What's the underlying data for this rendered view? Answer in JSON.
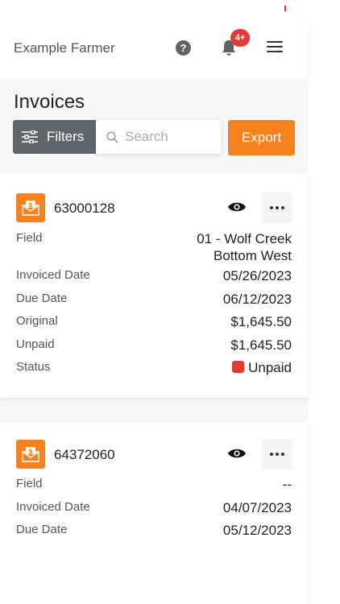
{
  "header": {
    "farmer_name": "Example Farmer",
    "help_icon_label": "?",
    "notification_count": "4+"
  },
  "page": {
    "title": "Invoices",
    "filters_label": "Filters",
    "search_placeholder": "Search",
    "export_label": "Export"
  },
  "invoices": [
    {
      "number": "63000128",
      "field_label": "Field",
      "field_value_line1": "01 - Wolf Creek",
      "field_value_line2": "Bottom West",
      "invoiced_date_label": "Invoiced Date",
      "invoiced_date": "05/26/2023",
      "due_date_label": "Due Date",
      "due_date": "06/12/2023",
      "original_label": "Original",
      "original": "$1,645.50",
      "unpaid_label": "Unpaid",
      "unpaid": "$1,645.50",
      "status_label": "Status",
      "status": "Unpaid"
    },
    {
      "number": "64372060",
      "field_label": "Field",
      "field_value": "--",
      "invoiced_date_label": "Invoiced Date",
      "invoiced_date": "04/07/2023",
      "due_date_label": "Due Date",
      "due_date": "05/12/2023"
    }
  ],
  "colors": {
    "accent": "#f5821f",
    "status_unpaid": "#e53935",
    "filters_bg": "#5f676c",
    "badge": "#e53935"
  },
  "icons": {
    "help": "help-icon",
    "notifications": "bell-icon",
    "menu": "hamburger-menu-icon",
    "filters": "sliders-icon",
    "search": "search-icon",
    "invoice": "invoice-envelope-icon",
    "view": "eye-icon",
    "more": "more-horizontal-icon"
  }
}
